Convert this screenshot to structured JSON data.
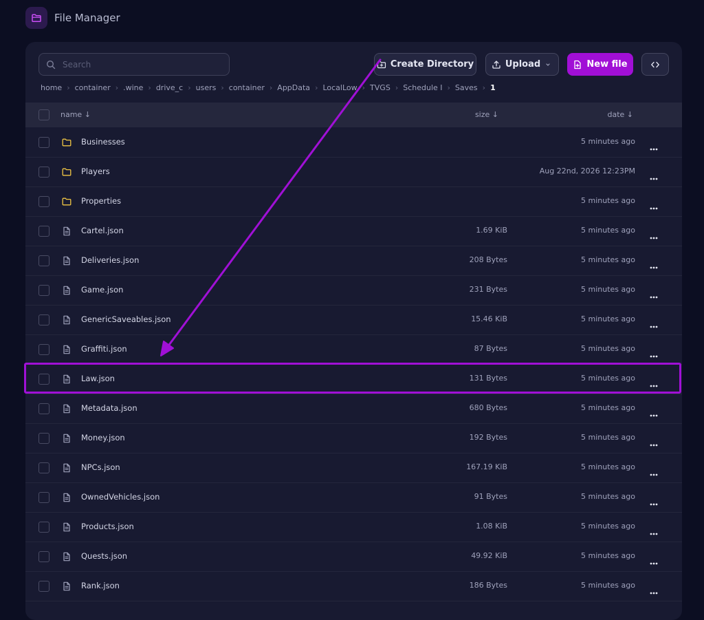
{
  "app": {
    "title": "File Manager",
    "logo_icon": "folder-icon"
  },
  "toolbar": {
    "search_placeholder": "Search",
    "create_directory_label": "Create Directory",
    "upload_label": "Upload",
    "new_file_label": "New file"
  },
  "breadcrumb": [
    "home",
    "container",
    ".wine",
    "drive_c",
    "users",
    "container",
    "AppData",
    "LocalLow",
    "TVGS",
    "Schedule I",
    "Saves",
    "1"
  ],
  "table": {
    "headers": {
      "name": "name ↓",
      "size": "size ↓",
      "date": "date ↓"
    },
    "rows": [
      {
        "type": "folder",
        "name": "Businesses",
        "size": "",
        "date": "5 minutes ago"
      },
      {
        "type": "folder",
        "name": "Players",
        "size": "",
        "date": "Aug 22nd, 2026 12:23PM"
      },
      {
        "type": "folder",
        "name": "Properties",
        "size": "",
        "date": "5 minutes ago"
      },
      {
        "type": "file",
        "name": "Cartel.json",
        "size": "1.69 KiB",
        "date": "5 minutes ago"
      },
      {
        "type": "file",
        "name": "Deliveries.json",
        "size": "208 Bytes",
        "date": "5 minutes ago"
      },
      {
        "type": "file",
        "name": "Game.json",
        "size": "231 Bytes",
        "date": "5 minutes ago"
      },
      {
        "type": "file",
        "name": "GenericSaveables.json",
        "size": "15.46 KiB",
        "date": "5 minutes ago"
      },
      {
        "type": "file",
        "name": "Graffiti.json",
        "size": "87 Bytes",
        "date": "5 minutes ago"
      },
      {
        "type": "file",
        "name": "Law.json",
        "size": "131 Bytes",
        "date": "5 minutes ago"
      },
      {
        "type": "file",
        "name": "Metadata.json",
        "size": "680 Bytes",
        "date": "5 minutes ago"
      },
      {
        "type": "file",
        "name": "Money.json",
        "size": "192 Bytes",
        "date": "5 minutes ago"
      },
      {
        "type": "file",
        "name": "NPCs.json",
        "size": "167.19 KiB",
        "date": "5 minutes ago"
      },
      {
        "type": "file",
        "name": "OwnedVehicles.json",
        "size": "91 Bytes",
        "date": "5 minutes ago"
      },
      {
        "type": "file",
        "name": "Products.json",
        "size": "1.08 KiB",
        "date": "5 minutes ago"
      },
      {
        "type": "file",
        "name": "Quests.json",
        "size": "49.92 KiB",
        "date": "5 minutes ago"
      },
      {
        "type": "file",
        "name": "Rank.json",
        "size": "186 Bytes",
        "date": "5 minutes ago"
      }
    ]
  },
  "annotation": {
    "highlighted_row": "Law.json",
    "color": "#a010d6"
  },
  "colors": {
    "background": "#0c0e22",
    "panel": "#181a31",
    "accent": "#a10fd6",
    "folder": "#f2c744"
  }
}
